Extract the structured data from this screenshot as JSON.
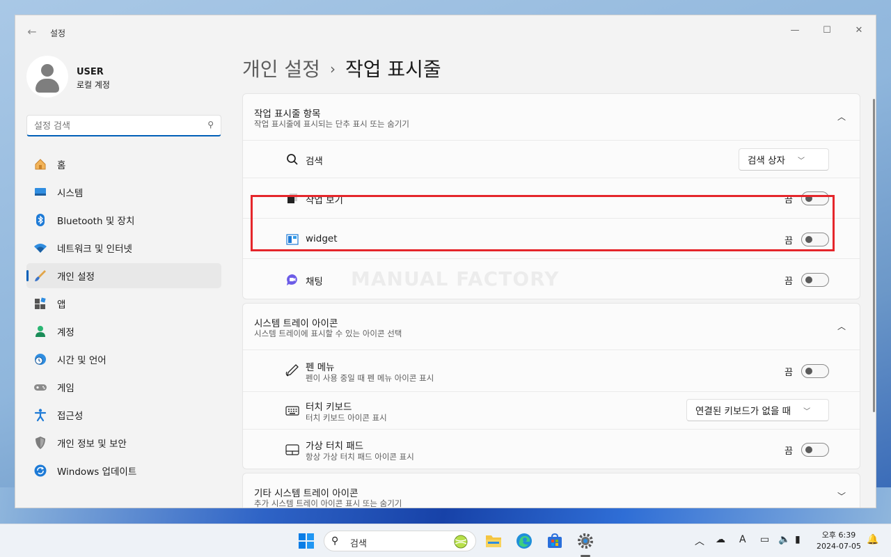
{
  "window": {
    "app_title": "설정",
    "controls": {
      "minimize": "—",
      "maximize": "☐",
      "close": "✕"
    }
  },
  "user": {
    "name": "USER",
    "account_type": "로컬 계정"
  },
  "search": {
    "placeholder": "설정 검색"
  },
  "nav": {
    "items": [
      {
        "label": "홈",
        "icon": "home-icon"
      },
      {
        "label": "시스템",
        "icon": "system-icon"
      },
      {
        "label": "Bluetooth 및 장치",
        "icon": "bluetooth-icon"
      },
      {
        "label": "네트워크 및 인터넷",
        "icon": "wifi-icon"
      },
      {
        "label": "개인 설정",
        "icon": "brush-icon",
        "active": true
      },
      {
        "label": "앱",
        "icon": "apps-icon"
      },
      {
        "label": "계정",
        "icon": "account-icon"
      },
      {
        "label": "시간 및 언어",
        "icon": "globe-clock-icon"
      },
      {
        "label": "게임",
        "icon": "gamepad-icon"
      },
      {
        "label": "접근성",
        "icon": "accessibility-icon"
      },
      {
        "label": "개인 정보 및 보안",
        "icon": "shield-icon"
      },
      {
        "label": "Windows 업데이트",
        "icon": "update-icon"
      }
    ]
  },
  "breadcrumb": {
    "parent": "개인 설정",
    "separator": "›",
    "current": "작업 표시줄"
  },
  "taskbar_items": {
    "title": "작업 표시줄 항목",
    "subtitle": "작업 표시줄에 표시되는 단추 표시 또는 숨기기",
    "rows": {
      "search": {
        "label": "검색",
        "value": "검색 상자"
      },
      "task_view": {
        "label": "작업 보기",
        "state": "끔"
      },
      "widget": {
        "label": "widget",
        "state": "끔"
      },
      "chat": {
        "label": "채팅",
        "state": "끔"
      }
    }
  },
  "system_tray": {
    "title": "시스템 트레이 아이콘",
    "subtitle": "시스템 트레이에 표시할 수 있는 아이콘 선택",
    "rows": {
      "pen_menu": {
        "label": "펜 메뉴",
        "sub": "펜이 사용 중일 때 펜 메뉴 아이콘 표시",
        "state": "끔"
      },
      "touch_keyboard": {
        "label": "터치 키보드",
        "sub": "터치 키보드 아이콘 표시",
        "value": "연결된 키보드가 없을 때"
      },
      "touchpad": {
        "label": "가상 터치 패드",
        "sub": "항상 가상 터치 패드 아이콘 표시",
        "state": "끔"
      }
    }
  },
  "other_tray": {
    "title": "기타 시스템 트레이 아이콘",
    "subtitle": "추가 시스템 트레이 아이콘 표시 또는 숨기기"
  },
  "watermark": "MANUAL FACTORY",
  "taskbar": {
    "search_text": "검색",
    "clock_time": "오후 6:39",
    "clock_date": "2024-07-05"
  },
  "colors": {
    "accent": "#005fb8",
    "highlight": "#e5262b"
  }
}
